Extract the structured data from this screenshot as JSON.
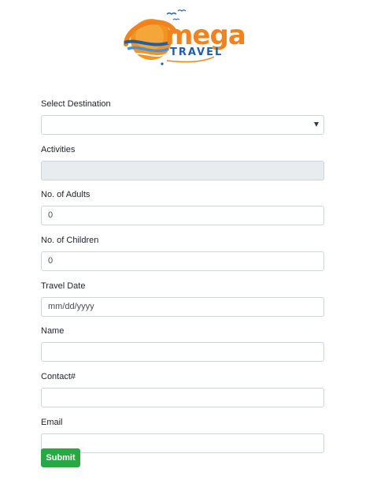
{
  "brand": {
    "logo_big": "mega",
    "logo_small": "TRAVEL"
  },
  "form": {
    "destination": {
      "label": "Select Destination",
      "value": ""
    },
    "activities": {
      "label": "Activities",
      "value": ""
    },
    "adults": {
      "label": "No. of Adults",
      "value": "0"
    },
    "children": {
      "label": "No. of Children",
      "value": "0"
    },
    "travel_date": {
      "label": "Travel Date",
      "placeholder": "mm/dd/yyyy"
    },
    "name": {
      "label": "Name",
      "value": ""
    },
    "contact": {
      "label": "Contact#",
      "value": ""
    },
    "email": {
      "label": "Email",
      "value": ""
    },
    "submit_label": "Submit"
  },
  "colors": {
    "brand_orange": "#f0831e",
    "brand_blue": "#1f5fa8",
    "submit_green": "#28a745",
    "input_border": "#ced4da",
    "readonly_bg": "#e9ecef"
  },
  "icons": {
    "logo": "omega-travel-logo",
    "select_caret": "chevron-down-icon"
  }
}
